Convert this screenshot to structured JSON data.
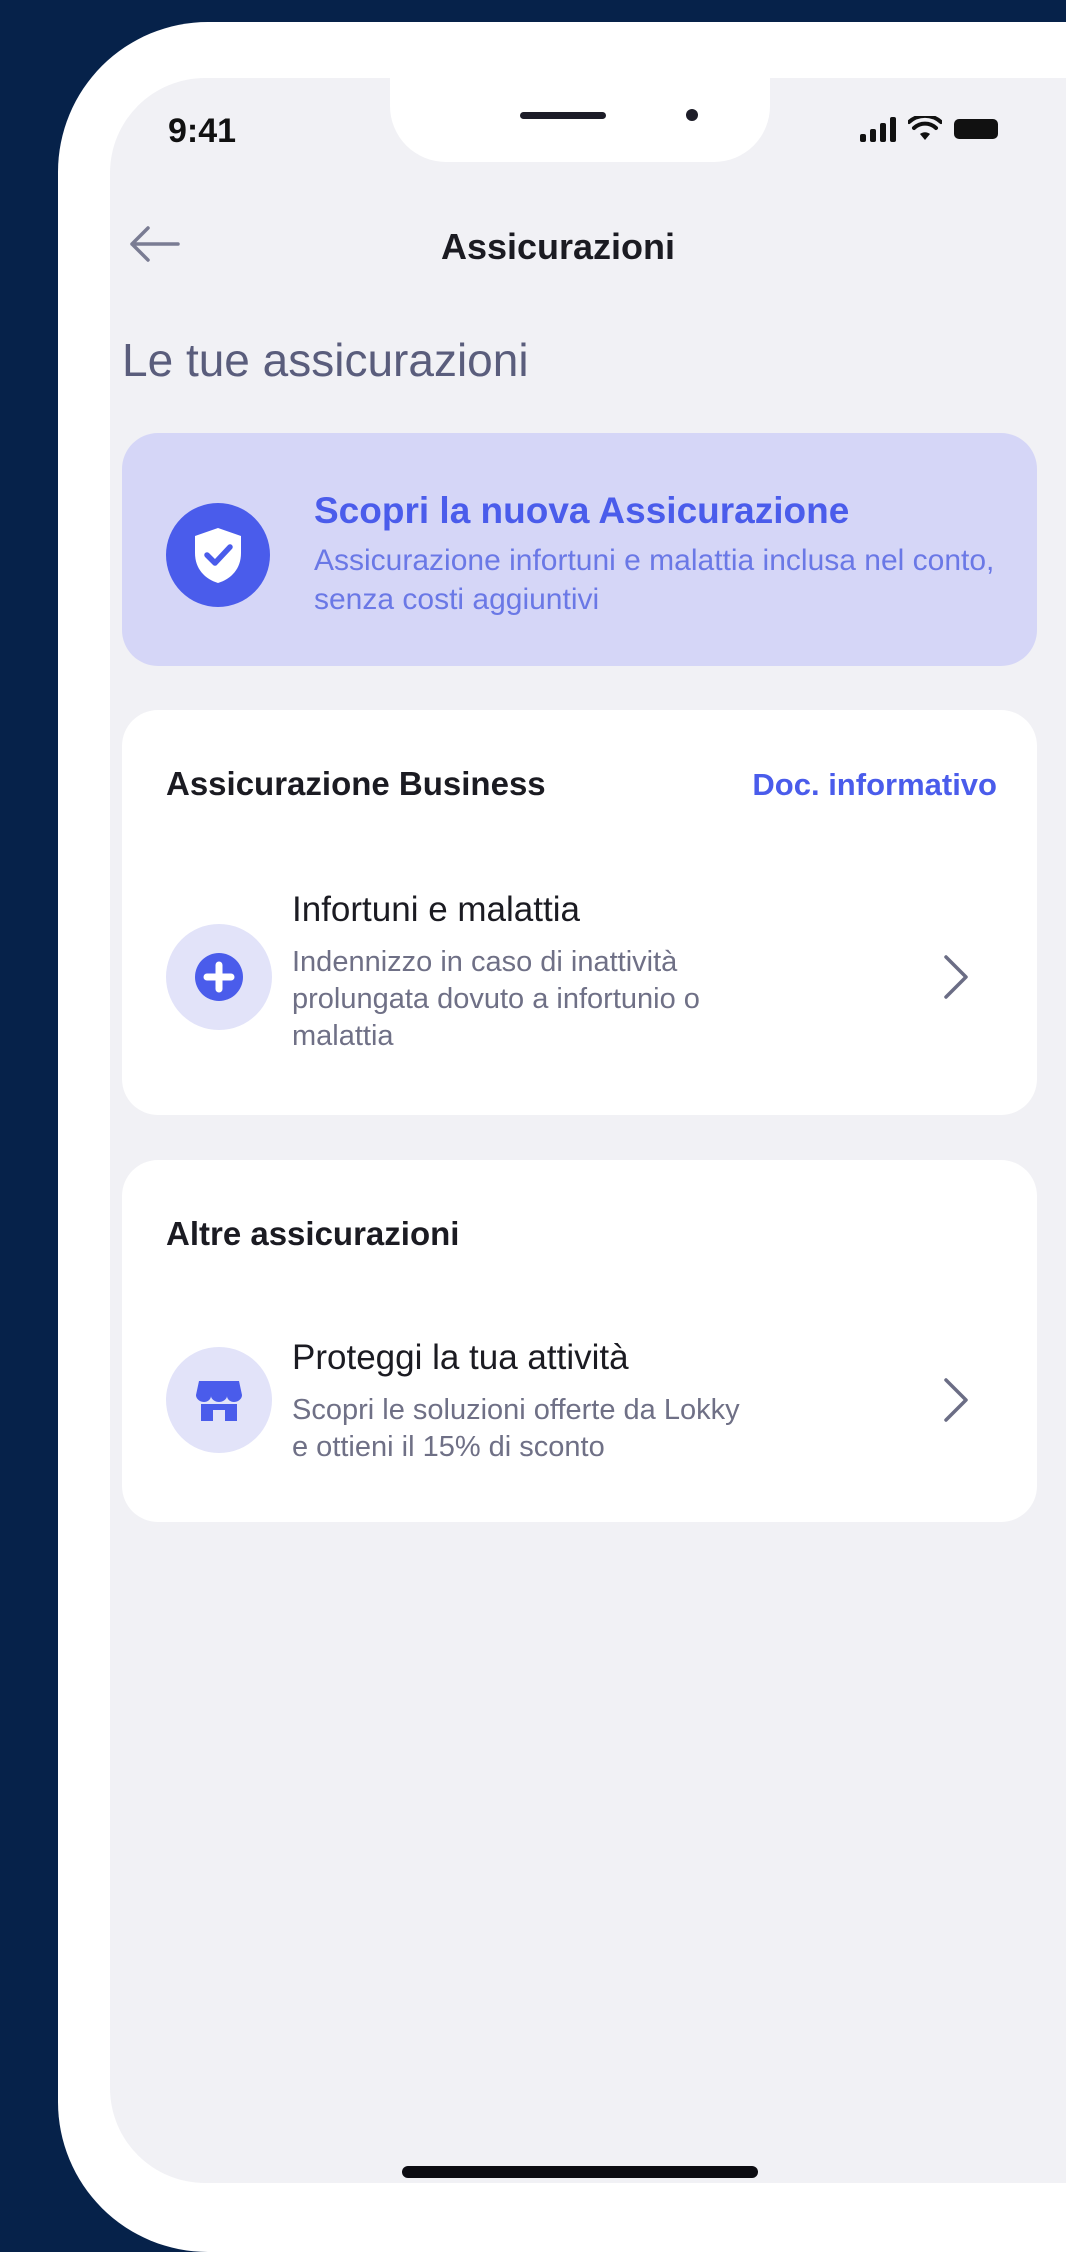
{
  "status_bar": {
    "time": "9:41"
  },
  "header": {
    "title": "Assicurazioni"
  },
  "section": {
    "heading": "Le tue assicurazioni"
  },
  "promo": {
    "title": "Scopri la nuova Assicurazione",
    "description": "Assicurazione infortuni e malattia inclusa nel conto, senza costi aggiuntivi",
    "icon": "shield-check-icon"
  },
  "business_card": {
    "title": "Assicurazione Business",
    "link": "Doc. informativo",
    "item": {
      "title": "Infortuni e malattia",
      "description": "Indennizzo in caso di inattività prolungata dovuto a infortunio o malattia",
      "icon": "plus-circle-icon"
    }
  },
  "other_card": {
    "title": "Altre assicurazioni",
    "item": {
      "title": "Proteggi la tua attività",
      "description": "Scopri le soluzioni offerte da Lokky e ottieni il 15% di sconto",
      "icon": "store-icon"
    }
  },
  "colors": {
    "background": "#06224a",
    "accent": "#4a5ceb",
    "promo_bg": "#d5d6f7",
    "screen_bg": "#f1f1f5"
  }
}
